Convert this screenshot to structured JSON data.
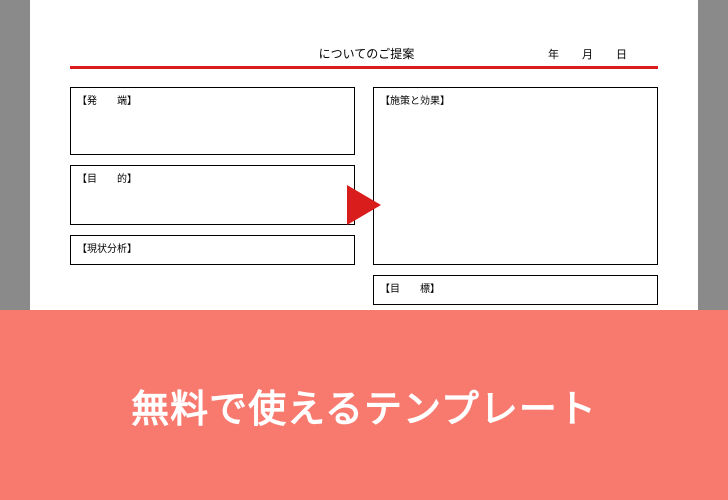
{
  "document": {
    "titleSuffix": "についてのご提案",
    "dateLabel": "年　月　日",
    "sections": {
      "hassou": "【発　　端】",
      "mokuteki": "【目　　的】",
      "genjyo": "【現状分析】",
      "shisaku": "【施策と効果】",
      "mokuhyou": "【目　　標】"
    }
  },
  "banner": {
    "text": "無料で使えるテンプレート"
  },
  "colors": {
    "accentRed": "#d91c1c",
    "bannerBg": "#f87a6f",
    "arrowFill": "#d91c1c"
  }
}
